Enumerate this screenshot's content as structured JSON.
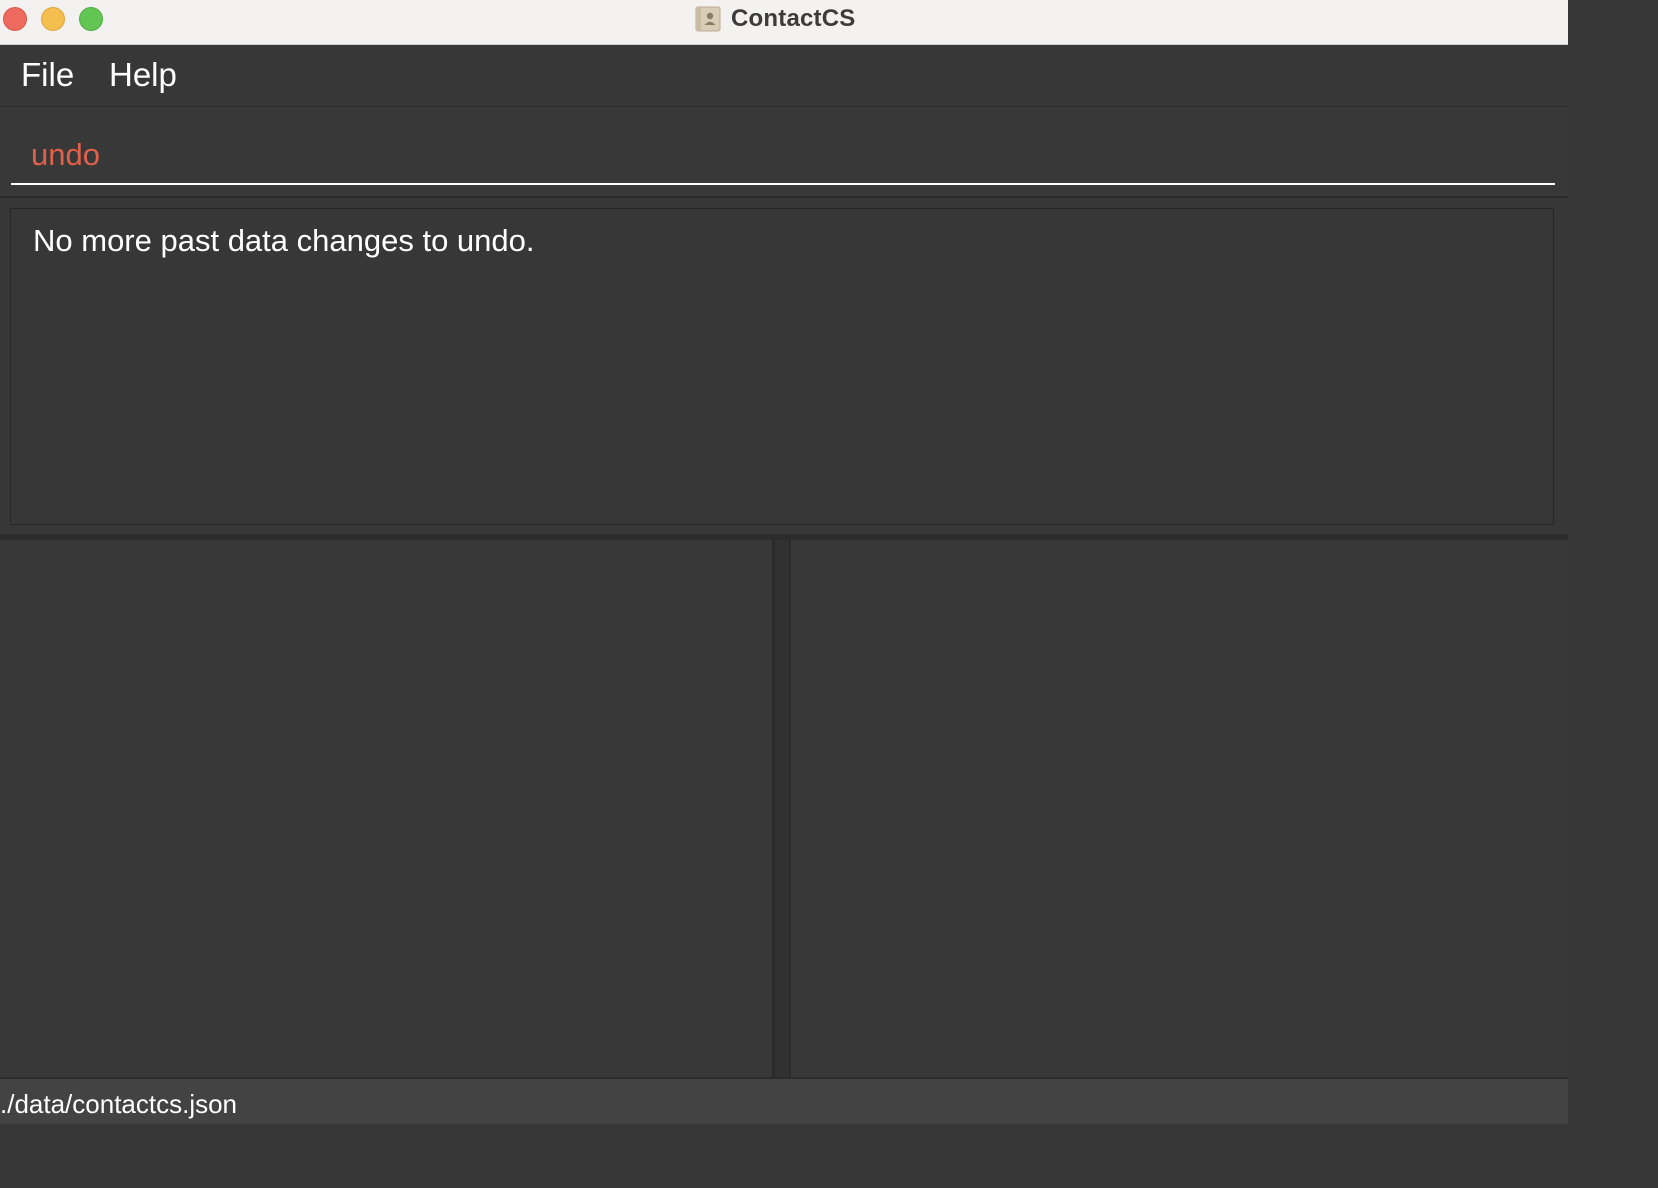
{
  "window": {
    "title": "ContactCS"
  },
  "icons": {
    "app": "contacts-book-icon"
  },
  "menu": {
    "items": [
      {
        "label": "File"
      },
      {
        "label": "Help"
      }
    ]
  },
  "command": {
    "value": "undo"
  },
  "result": {
    "message": "No more past data changes to undo."
  },
  "status": {
    "file_path": "./data/contactcs.json"
  },
  "colors": {
    "command_text": "#e0604b",
    "background": "#373737",
    "status_bar": "#434343"
  }
}
